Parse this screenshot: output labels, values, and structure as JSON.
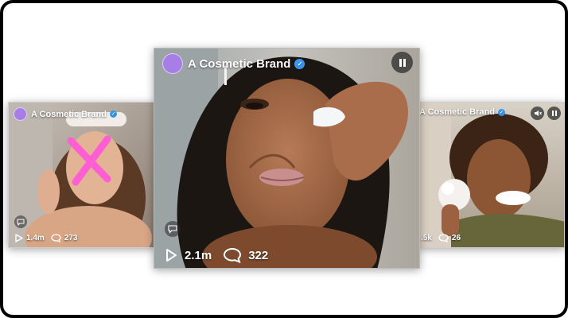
{
  "brand_name": "A Cosmetic Brand",
  "cards": {
    "left": {
      "views": "1.4m",
      "comments": "273"
    },
    "main": {
      "views": "2.1m",
      "comments": "322"
    },
    "right": {
      "views": ".5k",
      "comments": "26"
    }
  },
  "colors": {
    "avatar": "#a77ee6",
    "verified_badge": "#3897f0",
    "x_mark": "#ff5fd2"
  }
}
